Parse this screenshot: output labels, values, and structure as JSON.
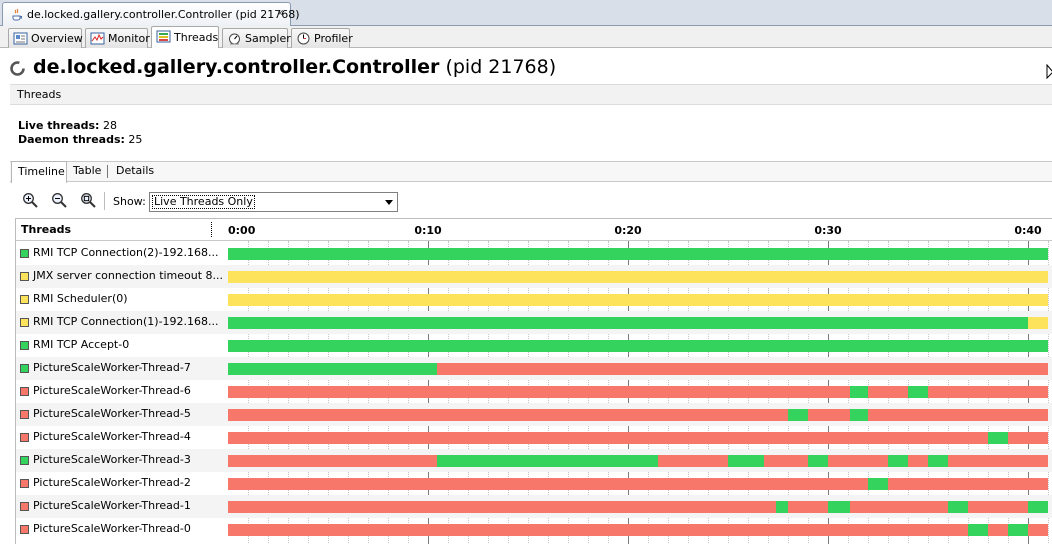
{
  "window": {
    "doc_tab_title": "de.locked.gallery.controller.Controller (pid 21768)",
    "doc_tab_close": "⨯"
  },
  "view_tabs": [
    {
      "label": "Overview",
      "icon": "overview-icon"
    },
    {
      "label": "Monitor",
      "icon": "monitor-icon"
    },
    {
      "label": "Threads",
      "icon": "threads-icon",
      "active": true
    },
    {
      "label": "Sampler",
      "icon": "sampler-icon"
    },
    {
      "label": "Profiler",
      "icon": "profiler-icon"
    }
  ],
  "header": {
    "app_name": "de.locked.gallery.controller.Controller",
    "pid": "(pid 21768)"
  },
  "section": {
    "title": "Threads"
  },
  "stats": {
    "live_label": "Live threads:",
    "live_value": "28",
    "daemon_label": "Daemon threads:",
    "daemon_value": "25"
  },
  "subtabs": [
    "Timeline",
    "Table",
    "Details"
  ],
  "toolbar": {
    "show_label": "Show:",
    "show_value": "Live Threads Only",
    "zoom_in": "zoom-in-icon",
    "zoom_out": "zoom-out-icon",
    "zoom_fit": "zoom-fit-icon"
  },
  "colors": {
    "running": "#33d35e",
    "sleeping": "#fde35c",
    "monitor": "#f8776b"
  },
  "timeline": {
    "column_header": "Threads",
    "time_end_seconds": 41,
    "ticks": [
      "0:00",
      "0:10",
      "0:20",
      "0:30",
      "0:40"
    ],
    "threads": [
      {
        "name": "RMI TCP Connection(2)-192.168...",
        "state": "running",
        "segments": [
          [
            "running",
            0,
            41
          ]
        ]
      },
      {
        "name": "JMX server connection timeout 8...",
        "state": "sleeping",
        "segments": [
          [
            "sleeping",
            0,
            41
          ]
        ]
      },
      {
        "name": "RMI Scheduler(0)",
        "state": "sleeping",
        "segments": [
          [
            "sleeping",
            0,
            41
          ]
        ]
      },
      {
        "name": "RMI TCP Connection(1)-192.168...",
        "state": "sleeping",
        "segments": [
          [
            "running",
            0,
            40
          ],
          [
            "sleeping",
            40,
            41
          ]
        ]
      },
      {
        "name": "RMI TCP Accept-0",
        "state": "running",
        "segments": [
          [
            "running",
            0,
            41
          ]
        ]
      },
      {
        "name": "PictureScaleWorker-Thread-7",
        "state": "running",
        "segments": [
          [
            "running",
            0,
            10.45
          ],
          [
            "monitor",
            10.45,
            41
          ]
        ]
      },
      {
        "name": "PictureScaleWorker-Thread-6",
        "state": "monitor",
        "segments": [
          [
            "monitor",
            0,
            31.1
          ],
          [
            "running",
            31.1,
            32
          ],
          [
            "monitor",
            32,
            34
          ],
          [
            "running",
            34,
            35
          ],
          [
            "monitor",
            35,
            41
          ]
        ]
      },
      {
        "name": "PictureScaleWorker-Thread-5",
        "state": "monitor",
        "segments": [
          [
            "monitor",
            0,
            28
          ],
          [
            "running",
            28,
            29
          ],
          [
            "monitor",
            29,
            31.1
          ],
          [
            "running",
            31.1,
            32
          ],
          [
            "monitor",
            32,
            41
          ]
        ]
      },
      {
        "name": "PictureScaleWorker-Thread-4",
        "state": "monitor",
        "segments": [
          [
            "monitor",
            0,
            38
          ],
          [
            "running",
            38,
            39
          ],
          [
            "monitor",
            39,
            41
          ]
        ]
      },
      {
        "name": "PictureScaleWorker-Thread-3",
        "state": "running",
        "segments": [
          [
            "monitor",
            0,
            10.45
          ],
          [
            "running",
            10.45,
            21.5
          ],
          [
            "monitor",
            21.5,
            25
          ],
          [
            "running",
            25,
            26.8
          ],
          [
            "monitor",
            26.8,
            29
          ],
          [
            "running",
            29,
            30
          ],
          [
            "monitor",
            30,
            33
          ],
          [
            "running",
            33,
            34
          ],
          [
            "monitor",
            34,
            35
          ],
          [
            "running",
            35,
            36
          ],
          [
            "monitor",
            36,
            41
          ]
        ]
      },
      {
        "name": "PictureScaleWorker-Thread-2",
        "state": "monitor",
        "segments": [
          [
            "monitor",
            0,
            32
          ],
          [
            "running",
            32,
            33
          ],
          [
            "monitor",
            33,
            41
          ]
        ]
      },
      {
        "name": "PictureScaleWorker-Thread-1",
        "state": "monitor",
        "segments": [
          [
            "monitor",
            0,
            27.4
          ],
          [
            "running",
            27.4,
            28
          ],
          [
            "monitor",
            28,
            30
          ],
          [
            "running",
            30,
            31.1
          ],
          [
            "monitor",
            31.1,
            36
          ],
          [
            "running",
            36,
            37
          ],
          [
            "monitor",
            37,
            40
          ],
          [
            "running",
            40,
            41
          ]
        ]
      },
      {
        "name": "PictureScaleWorker-Thread-0",
        "state": "monitor",
        "segments": [
          [
            "monitor",
            0,
            37
          ],
          [
            "running",
            37,
            38
          ],
          [
            "monitor",
            38,
            39
          ],
          [
            "running",
            39,
            40
          ],
          [
            "monitor",
            40,
            41
          ]
        ]
      }
    ]
  }
}
